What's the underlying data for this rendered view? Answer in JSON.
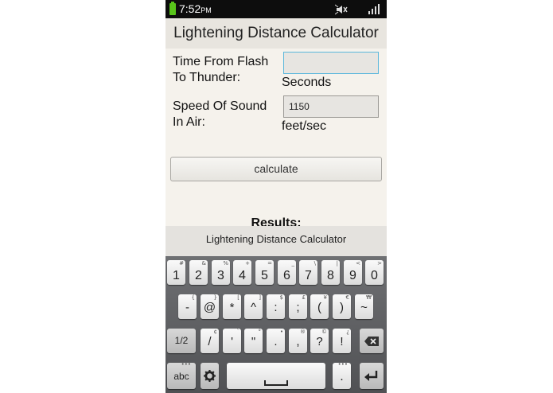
{
  "status_bar": {
    "time": "7:52",
    "ampm": "PM",
    "battery_color": "#58c41a"
  },
  "app": {
    "title": "Lightening Distance Calculator",
    "time_label_line1": "Time From Flash",
    "time_label_line2": "To Thunder:",
    "time_value": "",
    "time_unit": "Seconds",
    "speed_label_line1": "Speed Of Sound",
    "speed_label_line2": "In Air:",
    "speed_value": "1150",
    "speed_unit": "feet/sec",
    "calculate_label": "calculate",
    "results_label": "Results:"
  },
  "keyboard": {
    "header": "Lightening Distance Calculator",
    "number_row": [
      {
        "main": "1",
        "sub": "#"
      },
      {
        "main": "2",
        "sub": "&"
      },
      {
        "main": "3",
        "sub": "%"
      },
      {
        "main": "4",
        "sub": "+"
      },
      {
        "main": "5",
        "sub": "="
      },
      {
        "main": "6",
        "sub": "_"
      },
      {
        "main": "7",
        "sub": "\\"
      },
      {
        "main": "8",
        "sub": "|"
      },
      {
        "main": "9",
        "sub": "<"
      },
      {
        "main": "0",
        "sub": ">"
      }
    ],
    "symbol_row": [
      {
        "main": "-",
        "sub": "{"
      },
      {
        "main": "@",
        "sub": "}"
      },
      {
        "main": "*",
        "sub": "["
      },
      {
        "main": "^",
        "sub": "]"
      },
      {
        "main": ":",
        "sub": "$"
      },
      {
        "main": ";",
        "sub": "£"
      },
      {
        "main": "(",
        "sub": "¥"
      },
      {
        "main": ")",
        "sub": "€"
      },
      {
        "main": "~",
        "sub": "₩"
      }
    ],
    "punct_row": [
      {
        "main": "/",
        "sub": "¢"
      },
      {
        "main": "'",
        "sub": "`"
      },
      {
        "main": "\"",
        "sub": "°"
      },
      {
        "main": ".",
        "sub": "•"
      },
      {
        "main": ",",
        "sub": "®"
      },
      {
        "main": "?",
        "sub": "©"
      },
      {
        "main": "!",
        "sub": "¿"
      }
    ],
    "page_key": "1/2",
    "abc_key": "abc",
    "abc_sub": "•••",
    "period_key": ".",
    "period_sub": "•••",
    "icons": [
      "backspace-icon",
      "gear-icon",
      "space-icon",
      "enter-icon",
      "mute-icon",
      "signal-icon",
      "battery-icon"
    ]
  }
}
